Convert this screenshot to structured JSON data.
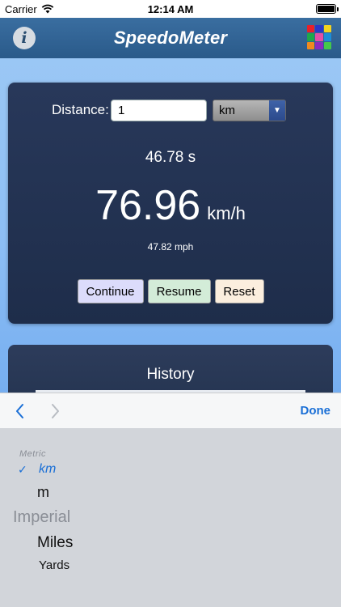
{
  "status_bar": {
    "carrier": "Carrier",
    "time": "12:14 AM"
  },
  "nav": {
    "title": "SpeedoMeter",
    "info_icon": "i",
    "grid_colors": [
      "#e8202a",
      "#2b37c8",
      "#f2d320",
      "#1fa84a",
      "#e34fa6",
      "#1c8ed8",
      "#f08a1e",
      "#8a2bc0",
      "#45c84a"
    ]
  },
  "main": {
    "distance_label": "Distance:",
    "distance_value": "1",
    "unit_selected": "km",
    "time": "46.78 s",
    "speed": "76.96",
    "speed_unit": "km/h",
    "secondary_speed": "47.82 mph",
    "buttons": {
      "continue": "Continue",
      "resume": "Resume",
      "reset": "Reset"
    }
  },
  "history": {
    "title": "History"
  },
  "toolbar": {
    "done": "Done"
  },
  "picker": {
    "group_metric": "Metric",
    "check": "✓",
    "km": "km",
    "m": "m",
    "group_imperial": "Imperial",
    "miles": "Miles",
    "yards": "Yards"
  },
  "colors": {
    "accent": "#1a6fd6",
    "nav_bar": "#2f6394",
    "card": "#243453"
  }
}
